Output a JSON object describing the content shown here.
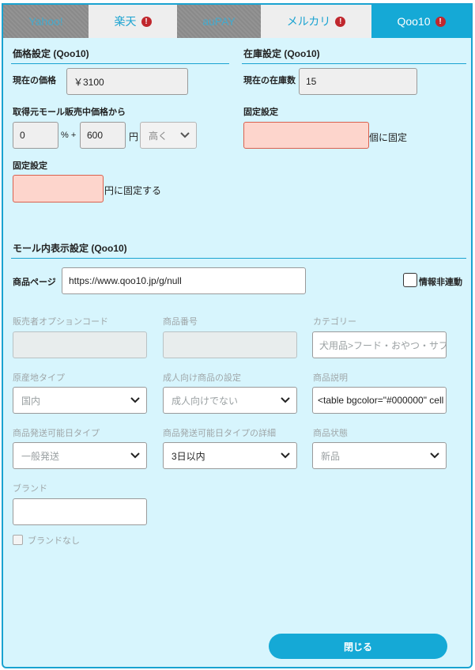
{
  "tabs": [
    {
      "label": "Yahoo!",
      "warn": false
    },
    {
      "label": "楽天",
      "warn": true
    },
    {
      "label": "auPAY",
      "warn": false
    },
    {
      "label": "メルカリ",
      "warn": true
    },
    {
      "label": "Qoo10",
      "warn": true
    }
  ],
  "tab_warn_glyph": "!",
  "price": {
    "title": "価格設定 (Qoo10)",
    "current_label": "現在の価格",
    "current_value": "￥3100",
    "from_label": "取得元モール販売中価格から",
    "percent_value": "0",
    "percent_unit": "% +",
    "yen_value": "600",
    "yen_unit": "円",
    "direction": "高く",
    "fixed_label": "固定設定",
    "fixed_value": "",
    "fixed_suffix": "円に固定する"
  },
  "stock": {
    "title": "在庫設定 (Qoo10)",
    "current_label": "現在の在庫数",
    "current_value": "15",
    "fixed_label": "固定設定",
    "fixed_value": "",
    "fixed_suffix": "個に固定"
  },
  "mall": {
    "title": "モール内表示設定 (Qoo10)",
    "product_page_label": "商品ページ",
    "product_page_value": "https://www.qoo10.jp/g/null",
    "info_nolink_label": "情報非連動",
    "fields": {
      "seller_option_code": {
        "label": "販売者オプションコード",
        "value": ""
      },
      "product_number": {
        "label": "商品番号",
        "value": ""
      },
      "category": {
        "label": "カテゴリー",
        "value": "犬用品>フード・おやつ・サプ"
      },
      "origin_type": {
        "label": "原産地タイプ",
        "value": "国内"
      },
      "adult_setting": {
        "label": "成人向け商品の設定",
        "value": "成人向けでない"
      },
      "description": {
        "label": "商品説明",
        "value": "<table bgcolor=\"#000000\" cell"
      },
      "ship_type": {
        "label": "商品発送可能日タイプ",
        "value": "一般発送"
      },
      "ship_detail": {
        "label": "商品発送可能日タイプの詳細",
        "value": "3日以内"
      },
      "condition": {
        "label": "商品状態",
        "value": "新品"
      },
      "brand": {
        "label": "ブランド",
        "value": ""
      },
      "no_brand": {
        "label": "ブランドなし"
      }
    }
  },
  "close_label": "閉じる",
  "colors": {
    "accent": "#15a9d6",
    "panel": "#d7f5fd",
    "warn": "#c0272d",
    "error_field": "#fdd5cc"
  }
}
